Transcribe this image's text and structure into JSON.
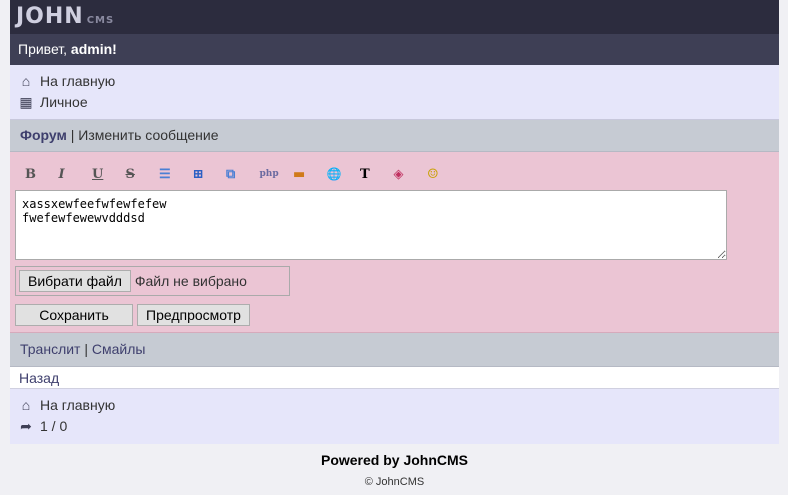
{
  "header": {
    "logo": "JOHN",
    "logo_sub": "CMS"
  },
  "greeting": {
    "prefix": "Привет, ",
    "user": "admin",
    "suffix": "!"
  },
  "top_menu": [
    {
      "icon": "home-icon",
      "label": "На главную"
    },
    {
      "icon": "grid-icon",
      "label": "Личное"
    }
  ],
  "breadcrumb": {
    "forum": "Форум",
    "sep": " | ",
    "current": "Изменить сообщение"
  },
  "toolbar": [
    "B",
    "I",
    "U",
    "S",
    "☰",
    "⊞",
    "⧉",
    "php",
    "▬",
    "🌐",
    "T",
    "◈",
    "☺"
  ],
  "editor": {
    "text": "xassxewfeefwfewfefew\nfwefewfewewvdddsd"
  },
  "file": {
    "button": "Вибрати файл",
    "status": "Файл не вибрано"
  },
  "buttons": {
    "save": "Сохранить",
    "preview": "Предпросмотр"
  },
  "links": {
    "translit": "Транслит",
    "sep": " | ",
    "smiles": "Смайлы",
    "back": "Назад"
  },
  "bottom_menu": [
    {
      "icon": "home-icon",
      "label": "На главную"
    },
    {
      "icon": "share-icon",
      "label": "1 / 0"
    }
  ],
  "footer": {
    "powered": "Powered by JohnCMS",
    "copyright": "© JohnCMS"
  }
}
